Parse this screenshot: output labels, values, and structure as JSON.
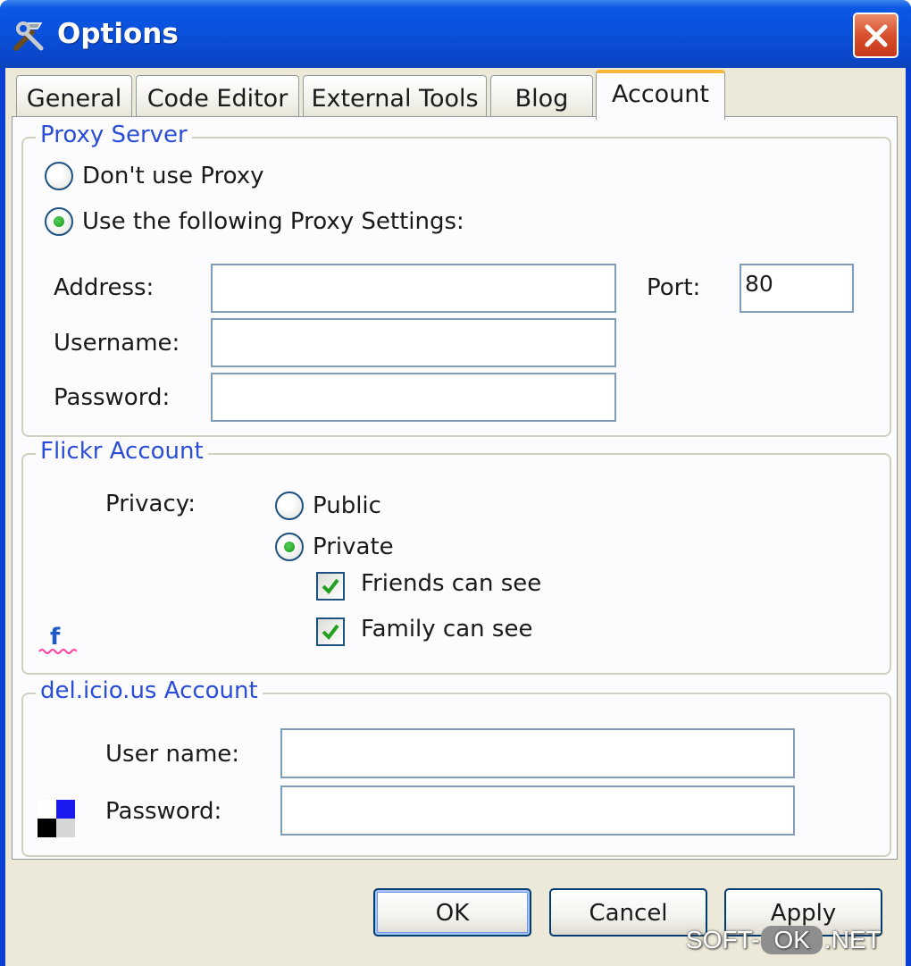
{
  "window": {
    "title": "Options",
    "title_icon": "tools-icon",
    "close_icon": "close-icon"
  },
  "tabs": [
    {
      "label": "General",
      "active": false
    },
    {
      "label": "Code Editor",
      "active": false
    },
    {
      "label": "External Tools",
      "active": false
    },
    {
      "label": "Blog",
      "active": false
    },
    {
      "label": "Account",
      "active": true
    }
  ],
  "proxy": {
    "title": "Proxy Server",
    "no_proxy_label": "Don't use Proxy",
    "use_proxy_label": "Use the following Proxy Settings:",
    "selected": "use_proxy",
    "address_label": "Address:",
    "address_value": "",
    "port_label": "Port:",
    "port_value": "80",
    "username_label": "Username:",
    "username_value": "",
    "password_label": "Password:",
    "password_value": ""
  },
  "flickr": {
    "title": "Flickr Account",
    "privacy_label": "Privacy:",
    "public_label": "Public",
    "private_label": "Private",
    "selected": "private",
    "friends_label": "Friends can see",
    "friends_checked": true,
    "family_label": "Family can see",
    "family_checked": true,
    "logo_icon": "flickr-logo-icon"
  },
  "delicious": {
    "title": "del.icio.us Account",
    "username_label": "User name:",
    "username_value": "",
    "password_label": "Password:",
    "password_value": "",
    "logo_icon": "delicious-logo-icon"
  },
  "buttons": {
    "ok": "OK",
    "cancel": "Cancel",
    "apply": "Apply"
  },
  "watermark": {
    "left": "SOFT-",
    "middle": "OK",
    "right": ".NET"
  },
  "colors": {
    "titlebar": "#0a4fd8",
    "dialog_bg": "#ece9d8",
    "group_title": "#2a4dd8",
    "active_tab_accent": "#f5b83b"
  }
}
